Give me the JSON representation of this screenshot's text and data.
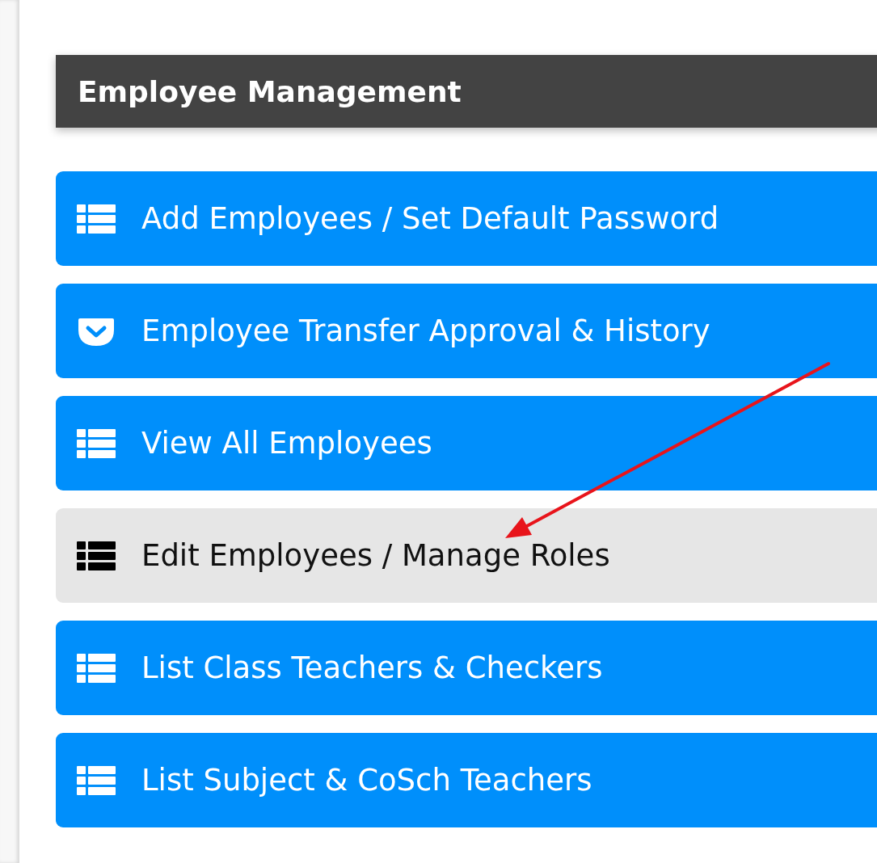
{
  "panel": {
    "title": "Employee Management"
  },
  "items": [
    {
      "label": "Add Employees / Set Default Password",
      "kind": "list",
      "selected": false
    },
    {
      "label": "Employee Transfer Approval & History",
      "kind": "pocket",
      "selected": false
    },
    {
      "label": "View All Employees",
      "kind": "list",
      "selected": false
    },
    {
      "label": "Edit Employees / Manage Roles",
      "kind": "list",
      "selected": true
    },
    {
      "label": "List Class Teachers & Checkers",
      "kind": "list",
      "selected": false
    },
    {
      "label": "List Subject & CoSch Teachers",
      "kind": "list",
      "selected": false
    }
  ]
}
